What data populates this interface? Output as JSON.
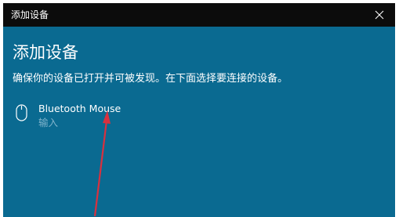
{
  "window": {
    "title": "添加设备"
  },
  "main": {
    "heading": "添加设备",
    "description": "确保你的设备已打开并可被发现。在下面选择要连接的设备。"
  },
  "devices": [
    {
      "name": "Bluetooth Mouse",
      "type": "输入",
      "icon": "mouse-icon"
    }
  ],
  "colors": {
    "window_background": "#0a6a91",
    "titlebar_background": "#0c0c0c",
    "annotation_arrow": "#d8313f"
  }
}
